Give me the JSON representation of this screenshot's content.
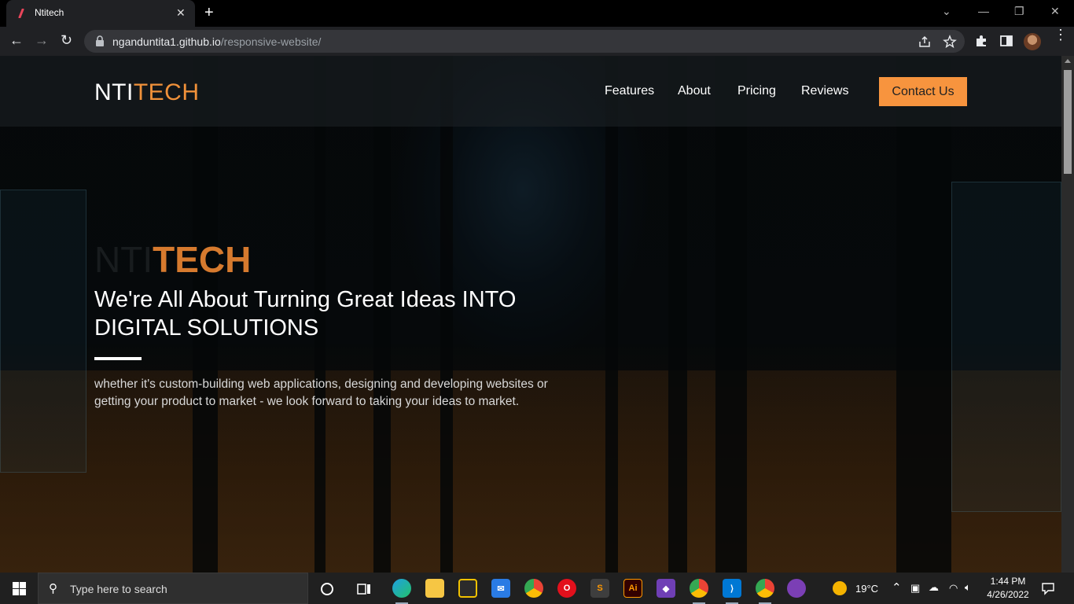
{
  "browser": {
    "tab_title": "Ntitech",
    "url_host": "nganduntita1.github.io",
    "url_path": "/responsive-website/"
  },
  "site": {
    "logo_part1": "NTI",
    "logo_part2": "TECH",
    "nav": [
      "Features",
      "About",
      "Pricing",
      "Reviews"
    ],
    "contact_label": "Contact Us",
    "hero_brand_ghost": "NTI",
    "hero_brand_accent": "TECH",
    "hero_title_line1": "We're All About Turning Great Ideas INTO",
    "hero_title_line2": "DIGITAL SOLUTIONS",
    "hero_text": "whether it's custom-building web applications, designing and developing websites or getting your product to market - we look forward to taking your ideas to market.",
    "accent_color": "#f7943e"
  },
  "taskbar": {
    "search_placeholder": "Type here to search",
    "temperature": "19°C",
    "time": "1:44 PM",
    "date": "4/26/2022",
    "pinned_apps": [
      "task-view",
      "edge",
      "file-explorer",
      "microsoft-store",
      "mail",
      "chrome",
      "opera",
      "sublime-text",
      "illustrator",
      "visual-studio",
      "chrome-dev",
      "vscode",
      "chrome-canary",
      "github-desktop"
    ]
  }
}
